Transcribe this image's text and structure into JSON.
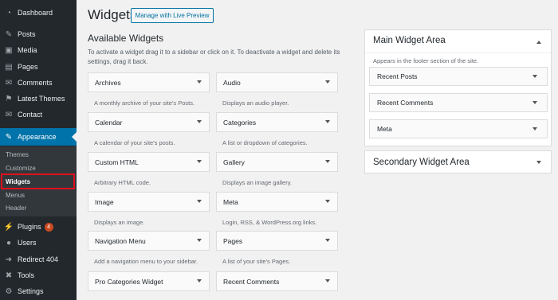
{
  "sidebar": {
    "items": [
      {
        "label": "Dashboard",
        "icon": "dashboard-icon",
        "glyph": "◔"
      },
      {
        "label": "Posts",
        "icon": "pin-icon",
        "glyph": "✎"
      },
      {
        "label": "Media",
        "icon": "media-icon",
        "glyph": "▣"
      },
      {
        "label": "Pages",
        "icon": "pages-icon",
        "glyph": "▤"
      },
      {
        "label": "Comments",
        "icon": "comments-icon",
        "glyph": "✉"
      },
      {
        "label": "Latest Themes",
        "icon": "themes-icon",
        "glyph": "⚑"
      },
      {
        "label": "Contact",
        "icon": "envelope-icon",
        "glyph": "✉"
      },
      {
        "label": "Appearance",
        "icon": "brush-icon",
        "glyph": "✎"
      },
      {
        "label": "Plugins",
        "icon": "plugin-icon",
        "glyph": "⚡",
        "badge": "4"
      },
      {
        "label": "Users",
        "icon": "users-icon",
        "glyph": "●"
      },
      {
        "label": "Redirect 404",
        "icon": "redirect-icon",
        "glyph": "➜"
      },
      {
        "label": "Tools",
        "icon": "wrench-icon",
        "glyph": "✖"
      },
      {
        "label": "Settings",
        "icon": "settings-icon",
        "glyph": "⚙"
      }
    ],
    "submenu": [
      "Themes",
      "Customize",
      "Widgets",
      "Menus",
      "Header"
    ]
  },
  "header": {
    "title": "Widgets",
    "preview_button": "Manage with Live Preview"
  },
  "available": {
    "title": "Available Widgets",
    "description": "To activate a widget drag it to a sidebar or click on it. To deactivate a widget and delete its settings, drag it back."
  },
  "widgets": [
    {
      "name": "Archives",
      "desc": "A monthly archive of your site's Posts."
    },
    {
      "name": "Audio",
      "desc": "Displays an audio player."
    },
    {
      "name": "Calendar",
      "desc": "A calendar of your site's posts."
    },
    {
      "name": "Categories",
      "desc": "A list or dropdown of categories."
    },
    {
      "name": "Custom HTML",
      "desc": "Arbitrary HTML code."
    },
    {
      "name": "Gallery",
      "desc": "Displays an image gallery."
    },
    {
      "name": "Image",
      "desc": "Displays an image."
    },
    {
      "name": "Meta",
      "desc": "Login, RSS, & WordPress.org links."
    },
    {
      "name": "Navigation Menu",
      "desc": "Add a navigation menu to your sidebar."
    },
    {
      "name": "Pages",
      "desc": "A list of your site's Pages."
    },
    {
      "name": "Pro Categories Widget",
      "desc": ""
    },
    {
      "name": "Recent Comments",
      "desc": ""
    }
  ],
  "main_area": {
    "title": "Main Widget Area",
    "description": "Appears in the footer section of the site.",
    "widgets": [
      "Recent Posts",
      "Recent Comments",
      "Meta"
    ]
  },
  "secondary_area": {
    "title": "Secondary Widget Area"
  }
}
